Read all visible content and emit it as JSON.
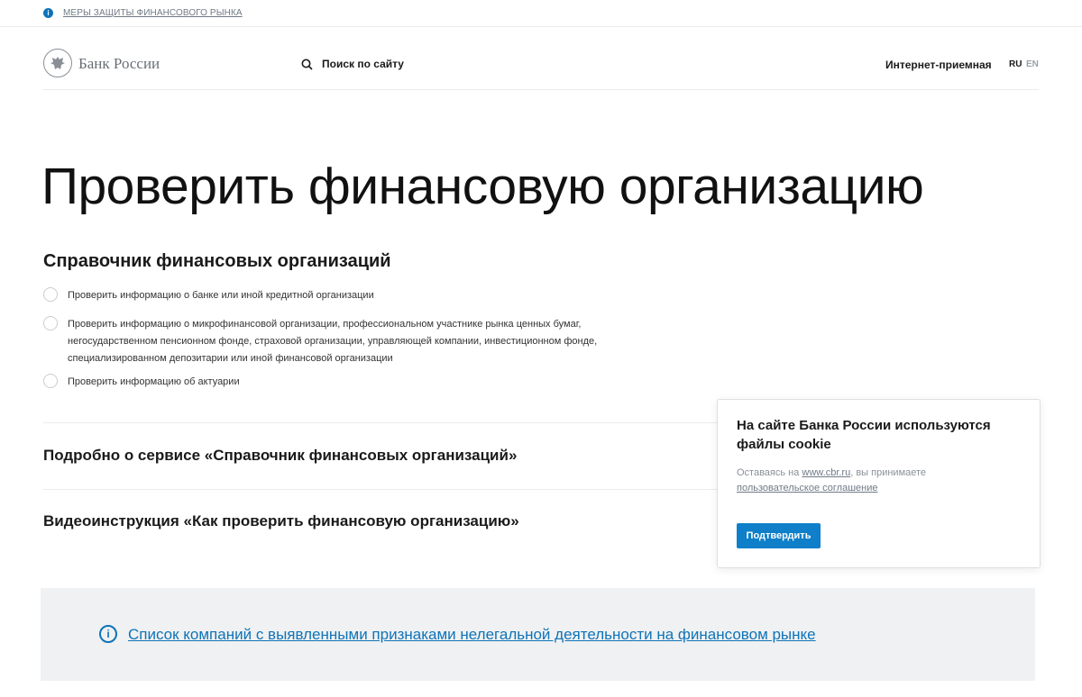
{
  "topbar": {
    "info_icon": "info-icon",
    "measures_link": "МЕРЫ ЗАЩИТЫ ФИНАНСОВОГО РЫНКА"
  },
  "header": {
    "logo_text": "Банк России",
    "logo_icon": "double-headed-eagle-emblem",
    "search_icon": "search-icon",
    "search_label": "Поиск по сайту",
    "reception_link": "Интернет-приемная",
    "lang_ru": "RU",
    "lang_en": "EN"
  },
  "main": {
    "title": "Проверить финансовую организацию",
    "section_title": "Справочник финансовых организаций",
    "options": [
      {
        "label": "Проверить информацию о банке или иной кредитной организации"
      },
      {
        "label": "Проверить информацию о микрофинансовой организации, профессиональном участнике рынка ценных бумаг, негосударственном пенсионном фонде, страховой организации, управляющей компании, инвестиционном фонде, специализированном депозитарии или иной финансовой организации"
      },
      {
        "label": "Проверить информацию об актуарии"
      }
    ],
    "accordion": [
      {
        "title": "Подробно о сервисе «Справочник финансовых организаций»"
      },
      {
        "title": "Видеоинструкция «Как проверить финансовую организацию»"
      }
    ]
  },
  "notice": {
    "icon": "info-circle-icon",
    "link": "Список компаний с выявленными признаками нелегальной деятельности на финансовом рынке"
  },
  "cookie": {
    "title": "На сайте Банка России используются файлы cookie",
    "text_prefix": "Оставаясь на ",
    "site_link": "www.cbr.ru",
    "text_middle": ", вы принимаете ",
    "agreement_link": "пользовательское соглашение",
    "confirm_button": "Подтвердить"
  },
  "colors": {
    "accent": "#0e74b9",
    "button": "#0e7fc8",
    "panel_bg": "#f0f1f2",
    "divider": "#ececec"
  }
}
